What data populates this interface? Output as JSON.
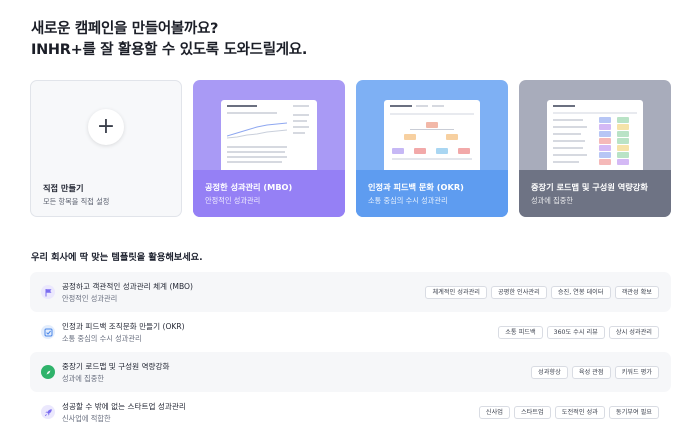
{
  "headline": {
    "line1": "새로운 캠페인을 만들어볼까요?",
    "line2": "INHR+를 잘 활용할 수 있도록 도와드릴게요."
  },
  "cards": [
    {
      "title": "직접 만들기",
      "subtitle": "모든 항목을 직접 설정",
      "icon": "plus-icon"
    },
    {
      "title": "공정한 성과관리 (MBO)",
      "subtitle": "안정적인 성과관리",
      "color": "#9580f5"
    },
    {
      "title": "인정과 피드백 문화 (OKR)",
      "subtitle": "소통 중심의 수시 성과관리",
      "color": "#5e9cf0"
    },
    {
      "title": "중장기 로드맵 및 구성원 역량강화",
      "subtitle": "성과에 집중한",
      "color": "#6e7384"
    }
  ],
  "section_title": "우리 회사에 딱 맞는 템플릿을 활용해보세요.",
  "templates": [
    {
      "title": "공정하고 객관적인 성과관리 체계 (MBO)",
      "subtitle": "안정적인 성과관리",
      "icon": "flag-icon",
      "icon_color": "#7b6cf0",
      "tags": [
        "체계적인 성과관리",
        "공평한 인사관리",
        "승진, 연봉 데이터",
        "객관성 확보"
      ]
    },
    {
      "title": "인정과 피드백 조직문화 만들기 (OKR)",
      "subtitle": "소통 중심의 수시 성과관리",
      "icon": "check-square-icon",
      "icon_color": "#4a86e8",
      "tags": [
        "소통 피드백",
        "360도 수시 리뷰",
        "상시 성과관리"
      ]
    },
    {
      "title": "중장기 로드맵 및 구성원 역량강화",
      "subtitle": "성과에 집중한",
      "icon": "compass-icon",
      "icon_color": "#2fb36b",
      "tags": [
        "성과향상",
        "육성 관점",
        "키워드 평가"
      ]
    },
    {
      "title": "성공할 수 밖에 없는 스타트업 성과관리",
      "subtitle": "신사업에 적합한",
      "icon": "rocket-icon",
      "icon_color": "#7b6cf0",
      "tags": [
        "신사업",
        "스타트업",
        "도전적인 성과",
        "동기부여 필요"
      ]
    }
  ]
}
